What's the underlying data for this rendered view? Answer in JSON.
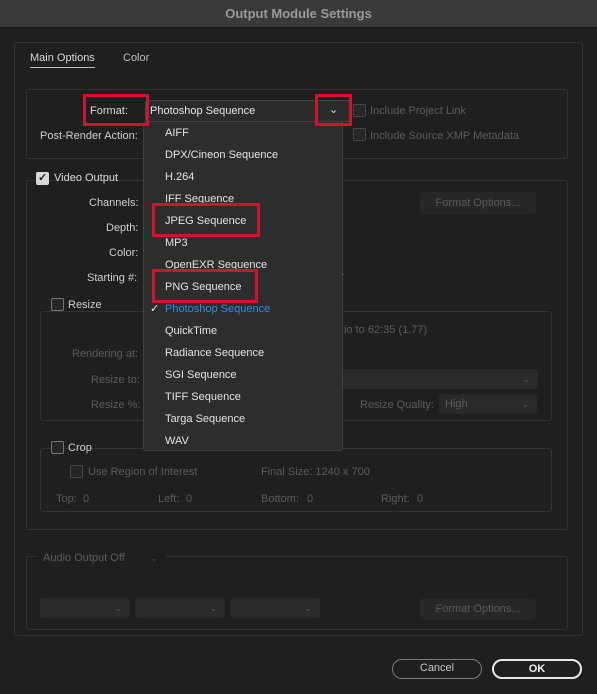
{
  "window": {
    "title": "Output Module Settings"
  },
  "tabs": {
    "main": "Main Options",
    "color": "Color"
  },
  "top_section": {
    "format_label": "Format:",
    "format_value": "Photoshop Sequence",
    "post_render_label": "Post-Render Action:",
    "include_project_link": "Include Project Link",
    "include_xmp": "Include Source XMP Metadata"
  },
  "video_output": {
    "label": "Video Output",
    "checked": true,
    "channels_label": "Channels:",
    "depth_label": "Depth:",
    "color_label": "Color:",
    "starting_label": "Starting #:",
    "format_options": "Format Options..."
  },
  "resize": {
    "label": "Resize",
    "aspect_text": "io to 62:35 (1.77)",
    "rendering_at_label": "Rendering at:",
    "resize_to_label": "Resize to:",
    "resize_pct_label": "Resize %:",
    "quality_label": "Resize Quality:",
    "quality_value": "High"
  },
  "crop": {
    "label": "Crop",
    "use_roi": "Use Region of Interest",
    "final_size": "Final Size: 1240 x 700",
    "top_label": "Top:",
    "top_value": "0",
    "left_label": "Left:",
    "left_value": "0",
    "bottom_label": "Bottom:",
    "bottom_value": "0",
    "right_label": "Right:",
    "right_value": "0"
  },
  "audio": {
    "label": "Audio Output Off",
    "format_options": "Format Options..."
  },
  "format_menu": {
    "items": [
      "AIFF",
      "DPX/Cineon Sequence",
      "H.264",
      "IFF Sequence",
      "JPEG Sequence",
      "MP3",
      "OpenEXR Sequence",
      "PNG Sequence",
      "Photoshop Sequence",
      "QuickTime",
      "Radiance Sequence",
      "SGI Sequence",
      "TIFF Sequence",
      "Targa Sequence",
      "WAV"
    ],
    "selected_index": 8,
    "check_glyph": "✓"
  },
  "buttons": {
    "cancel": "Cancel",
    "ok": "OK"
  },
  "colors": {
    "highlight": "#d0142c",
    "selected_text": "#2d8ceb"
  }
}
